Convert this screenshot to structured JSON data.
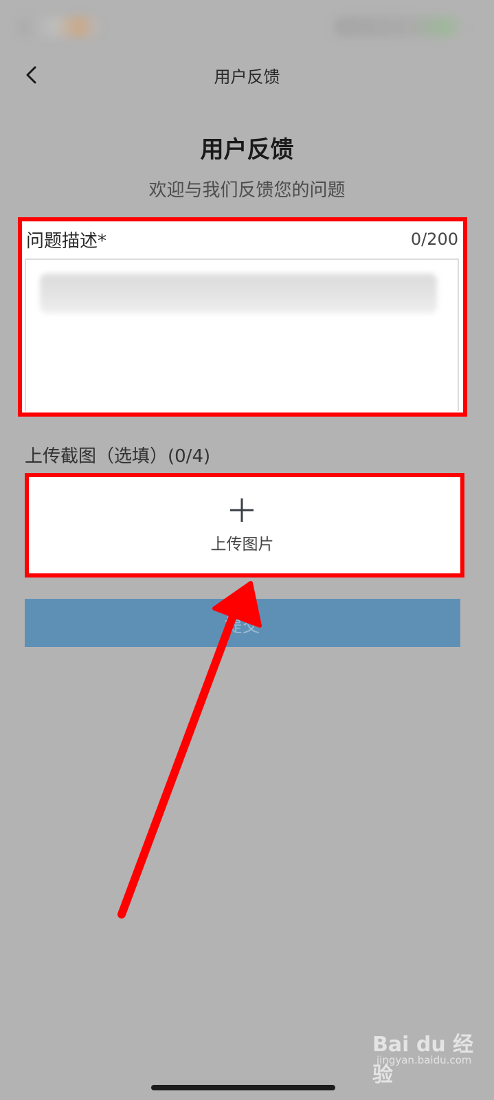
{
  "nav": {
    "title": "用户反馈"
  },
  "header": {
    "heading": "用户反馈",
    "subtitle": "欢迎与我们反馈您的问题"
  },
  "description": {
    "label": "问题描述*",
    "counter": "0/200",
    "value": ""
  },
  "upload": {
    "label": "上传截图（选填）(0/4)",
    "button_label": "上传图片",
    "icon": "plus-icon"
  },
  "submit": {
    "label": "提交"
  },
  "watermark": {
    "logo": "Bai du 经验",
    "url": "jingyan.baidu.com"
  },
  "colors": {
    "background": "#b3b3b3",
    "submit_button": "#5e90b6",
    "annotation": "#ff0000"
  }
}
